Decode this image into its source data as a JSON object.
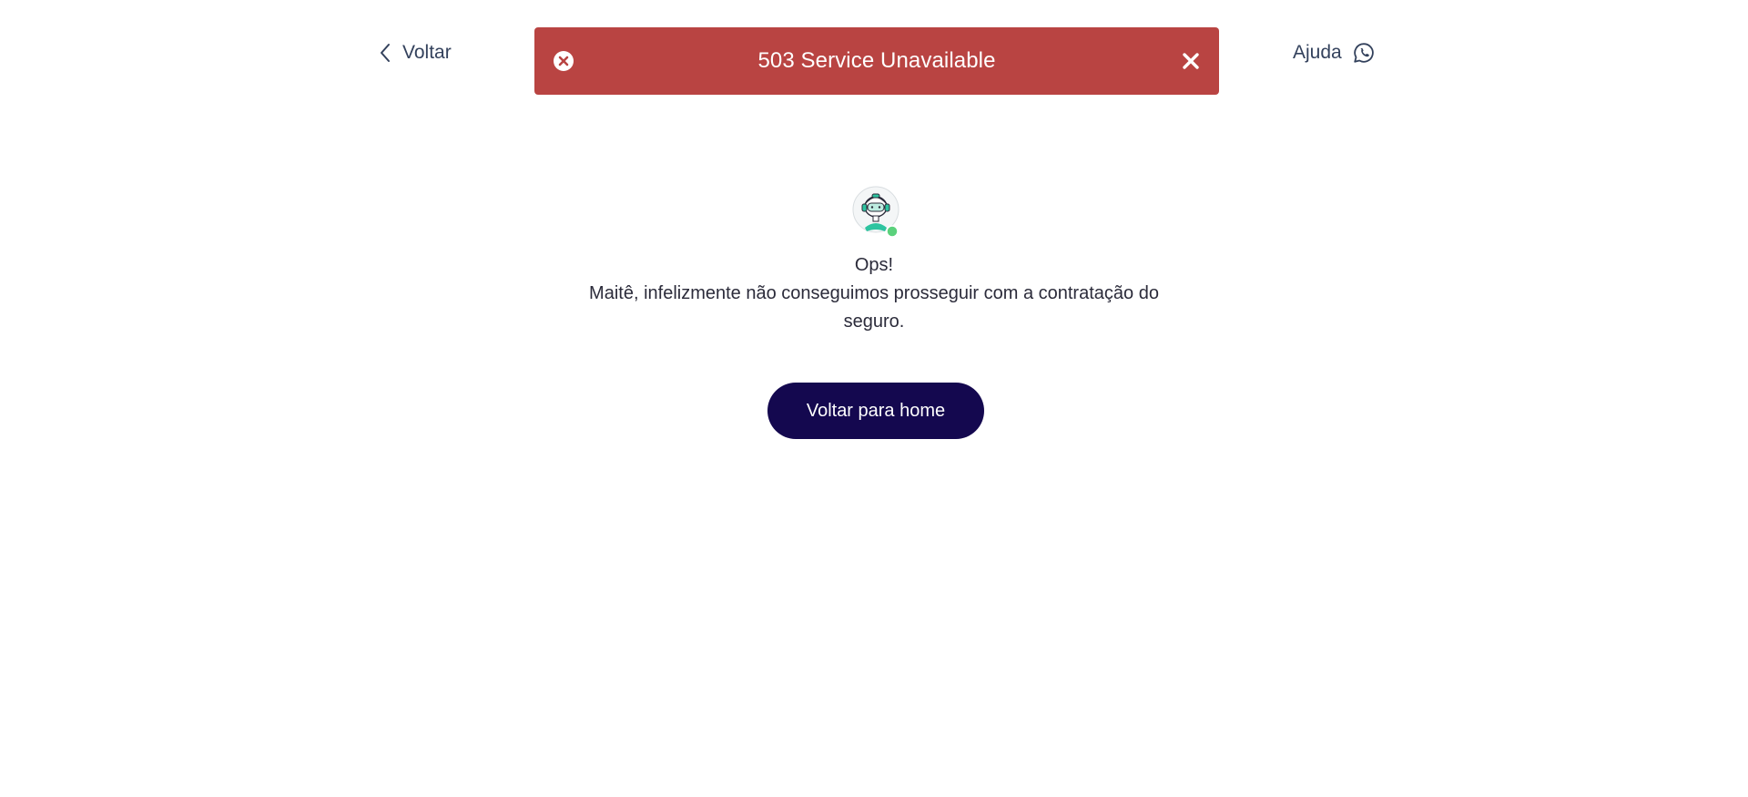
{
  "nav": {
    "back_label": "Voltar",
    "help_label": "Ajuda"
  },
  "toast": {
    "message": "503 Service Unavailable",
    "error_icon": "error-circle-icon",
    "close_icon": "close-icon",
    "background_color": "#b94442"
  },
  "content": {
    "avatar_icon": "robot-assistant-avatar",
    "title": "Ops!",
    "message": "Maitê, infelizmente não conseguimos prosseguir com a contratação do seguro."
  },
  "actions": {
    "home_button_label": "Voltar para home",
    "home_button_color": "#14084f"
  }
}
